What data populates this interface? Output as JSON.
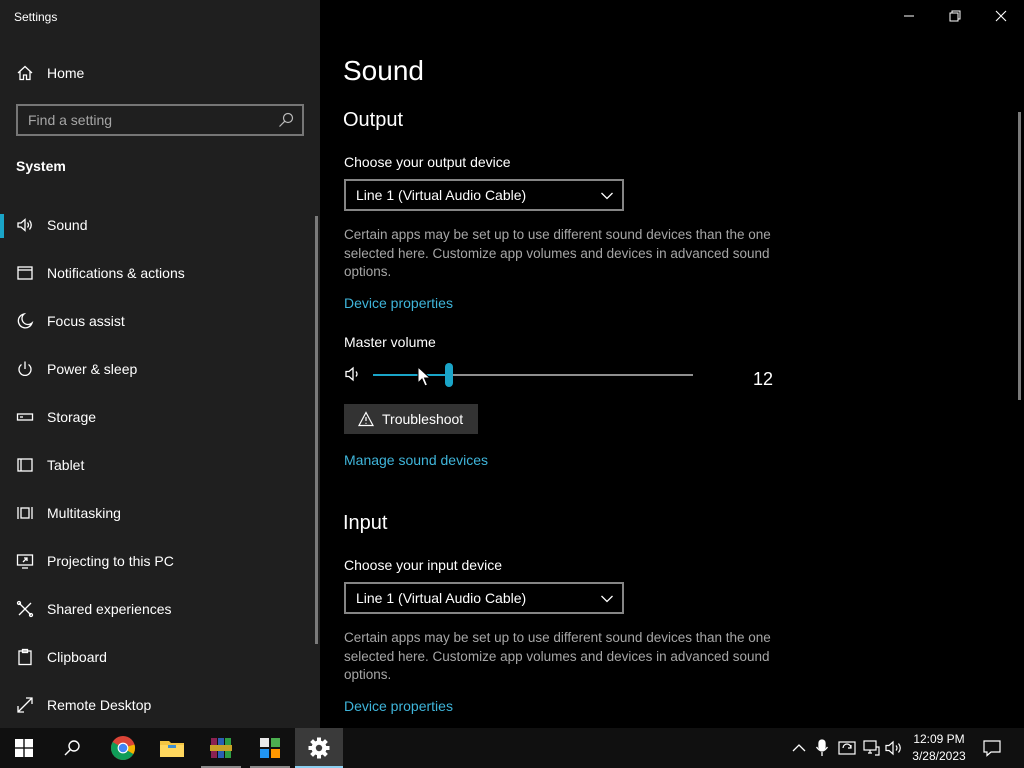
{
  "window": {
    "title": "Settings",
    "controls": [
      "minimize",
      "maximize",
      "close"
    ]
  },
  "sidebar": {
    "home_label": "Home",
    "search_placeholder": "Find a setting",
    "section": "System",
    "items": [
      {
        "label": "Sound",
        "icon": "speaker-icon",
        "active": true
      },
      {
        "label": "Notifications & actions",
        "icon": "notification-icon"
      },
      {
        "label": "Focus assist",
        "icon": "moon-icon"
      },
      {
        "label": "Power & sleep",
        "icon": "power-icon"
      },
      {
        "label": "Storage",
        "icon": "storage-icon"
      },
      {
        "label": "Tablet",
        "icon": "tablet-icon"
      },
      {
        "label": "Multitasking",
        "icon": "multitasking-icon"
      },
      {
        "label": "Projecting to this PC",
        "icon": "projecting-icon"
      },
      {
        "label": "Shared experiences",
        "icon": "shared-icon"
      },
      {
        "label": "Clipboard",
        "icon": "clipboard-icon"
      },
      {
        "label": "Remote Desktop",
        "icon": "remote-desktop-icon"
      }
    ]
  },
  "main": {
    "title": "Sound",
    "output": {
      "heading": "Output",
      "device_label": "Choose your output device",
      "device_value": "Line 1 (Virtual Audio Cable)",
      "description": "Certain apps may be set up to use different sound devices than the one selected here. Customize app volumes and devices in advanced sound options.",
      "properties_link": "Device properties",
      "volume_label": "Master volume",
      "volume_value": "12",
      "volume_level": 0.12,
      "troubleshoot_label": "Troubleshoot",
      "manage_link": "Manage sound devices"
    },
    "input": {
      "heading": "Input",
      "device_label": "Choose your input device",
      "device_value": "Line 1 (Virtual Audio Cable)",
      "description": "Certain apps may be set up to use different sound devices than the one selected here. Customize app volumes and devices in advanced sound options.",
      "properties_link": "Device properties"
    }
  },
  "taskbar": {
    "apps": [
      "start-button",
      "search-button",
      "chrome-icon",
      "file-explorer-icon",
      "winrar-icon",
      "app-icon",
      "settings-icon"
    ],
    "clock_time": "12:09 PM",
    "clock_date": "3/28/2023"
  },
  "colors": {
    "accent": "#1aa5c8",
    "link": "#3fb5da",
    "sidebar_bg": "#1f1f1f",
    "main_bg": "#000000"
  }
}
